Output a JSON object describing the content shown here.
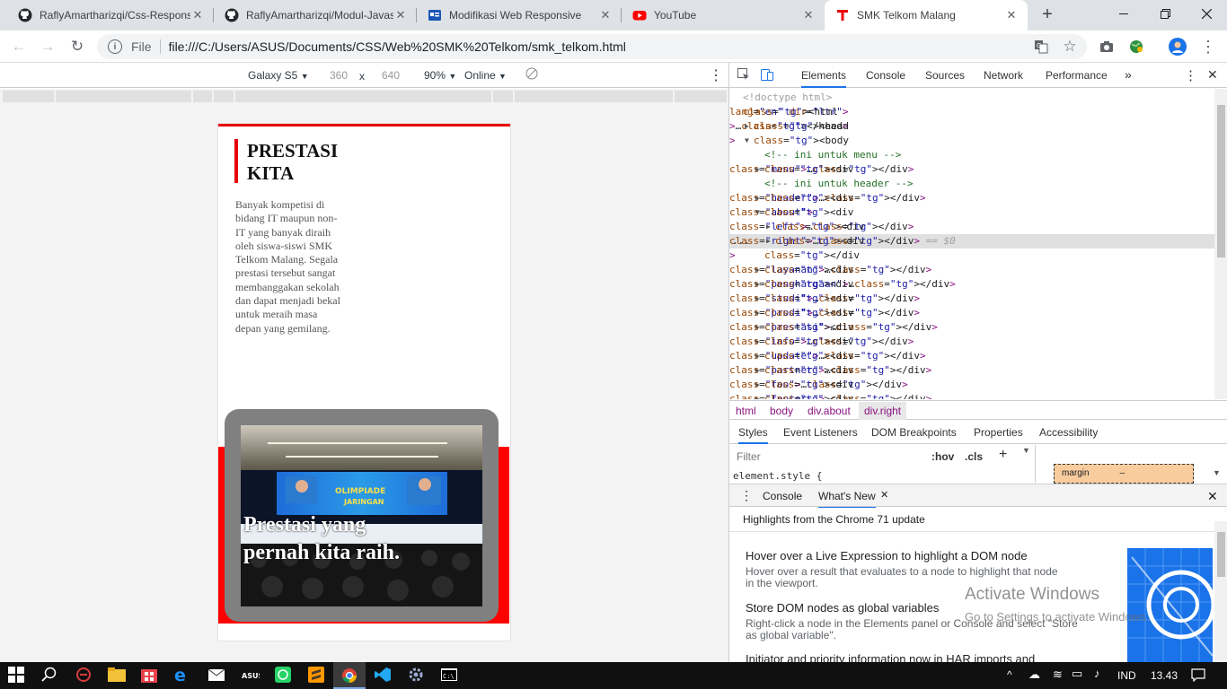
{
  "tabs": [
    {
      "title": "RaflyAmartharizqi/Css-Responsi",
      "icon": "github-icon"
    },
    {
      "title": "RaflyAmartharizqi/Modul-Javas",
      "icon": "github-icon"
    },
    {
      "title": "Modifikasi Web Responsive",
      "icon": "doc-icon"
    },
    {
      "title": "YouTube",
      "icon": "youtube-icon"
    },
    {
      "title": "SMK Telkom Malang",
      "icon": "telkom-icon"
    }
  ],
  "address": {
    "scheme_label": "File",
    "url": "file:///C:/Users/ASUS/Documents/CSS/Web%20SMK%20Telkom/smk_telkom.html"
  },
  "device": {
    "name": "Galaxy S5",
    "width": "360",
    "x": "x",
    "height": "640",
    "zoom": "90%",
    "network": "Online"
  },
  "page": {
    "heading_line1": "PRESTASI",
    "heading_line2": "KITA",
    "description": "Banyak kompetisi di bidang IT maupun non-IT yang banyak diraih oleh siswa-siswi SMK Telkom Malang. Segala prestasi tersebut sangat membanggakan sekolah dan dapat menjadi bekal untuk meraih masa depan yang gemilang.",
    "caption": "Prestasi yang pernah kita raih.",
    "photo_banner_line1": "OLIMPIADE",
    "photo_banner_line2": "JARINGAN"
  },
  "devtools": {
    "tabs": [
      "Elements",
      "Console",
      "Sources",
      "Network",
      "Performance"
    ],
    "more": "»",
    "dom_ellipsis": "...",
    "dom_lines": [
      {
        "indent": 0,
        "arrow": "",
        "html": "<!doctype html>",
        "kind": "doctype"
      },
      {
        "indent": 0,
        "arrow": "",
        "html": "<html lang=\"en\" dir=\"ltr\">",
        "kind": "tag"
      },
      {
        "indent": 1,
        "arrow": "▶",
        "html": "<head>…</head>",
        "kind": "tag"
      },
      {
        "indent": 1,
        "arrow": "▼",
        "html": "<body>",
        "kind": "tag"
      },
      {
        "indent": 2,
        "arrow": "",
        "html": "<!-- ini untuk menu -->",
        "kind": "comment"
      },
      {
        "indent": 2,
        "arrow": "▶",
        "html": "<div class=\"menu\">…</div>",
        "kind": "tag"
      },
      {
        "indent": 2,
        "arrow": "",
        "html": "<!-- ini untuk header -->",
        "kind": "comment"
      },
      {
        "indent": 2,
        "arrow": "▶",
        "html": "<div class=\"header\">…</div>",
        "kind": "tag"
      },
      {
        "indent": 2,
        "arrow": "▼",
        "html": "<div class=\"about\">",
        "kind": "tag"
      },
      {
        "indent": 3,
        "arrow": "▶",
        "html": "<div class=\"left\">…</div>",
        "kind": "tag"
      },
      {
        "indent": 3,
        "arrow": "▶",
        "html": "<div class=\"right\">…</div> == $0",
        "kind": "selected"
      },
      {
        "indent": 2,
        "arrow": "",
        "html": "</div>",
        "kind": "tag"
      },
      {
        "indent": 2,
        "arrow": "▶",
        "html": "<div class=\"layanan\">…</div>",
        "kind": "tag"
      },
      {
        "indent": 2,
        "arrow": "▶",
        "html": "<div class=\"penghargaan\">…</div>",
        "kind": "tag"
      },
      {
        "indent": 2,
        "arrow": "▶",
        "html": "<div class=\"studi\">…</div>",
        "kind": "tag"
      },
      {
        "indent": 2,
        "arrow": "▶",
        "html": "<div class=\"prodi\">…</div>",
        "kind": "tag"
      },
      {
        "indent": 2,
        "arrow": "▶",
        "html": "<div class=\"prestasi\">…</div>",
        "kind": "tag"
      },
      {
        "indent": 2,
        "arrow": "▶",
        "html": "<div class=\"info\">…</div>",
        "kind": "tag"
      },
      {
        "indent": 2,
        "arrow": "▶",
        "html": "<div class=\"update\">…</div>",
        "kind": "tag"
      },
      {
        "indent": 2,
        "arrow": "▶",
        "html": "<div class=\"partner\">…</div>",
        "kind": "tag"
      },
      {
        "indent": 2,
        "arrow": "▶",
        "html": "<div class=\"foo\">…</div>",
        "kind": "tag"
      },
      {
        "indent": 2,
        "arrow": "▶",
        "html": "<div class=\"footers\">…</div>",
        "kind": "tag"
      }
    ],
    "breadcrumbs": [
      "html",
      "body",
      "div.about",
      "div.right"
    ],
    "style_tabs": [
      "Styles",
      "Event Listeners",
      "DOM Breakpoints",
      "Properties",
      "Accessibility"
    ],
    "filter_placeholder": "Filter",
    "hov": ":hov",
    "cls": ".cls",
    "plus": "+",
    "element_style": "element.style {",
    "box_model_label": "margin",
    "box_model_value": "–",
    "drawer_tabs": [
      "Console",
      "What's New"
    ],
    "whats_new_header": "Highlights from the Chrome 71 update",
    "items": [
      {
        "title": "Hover over a Live Expression to highlight a DOM node",
        "body": "Hover over a result that evaluates to a node to highlight that node in the viewport."
      },
      {
        "title": "Store DOM nodes as global variables",
        "body": "Right-click a node in the Elements panel or Console and select \"Store as global variable\"."
      },
      {
        "title": "Initiator and priority information now in HAR imports and",
        "body": ""
      }
    ],
    "watermark_title": "Activate Windows",
    "watermark_sub": "Go to Settings to activate Windows."
  },
  "taskbar": {
    "lang": "IND",
    "time": "13.43"
  },
  "colors": {
    "accent_red": "#e8000b",
    "devtools_blue": "#1a73e8",
    "tag_purple": "#881280",
    "attr_brown": "#994500",
    "value_blue": "#1a1aa6",
    "comment_green": "#236e25"
  }
}
